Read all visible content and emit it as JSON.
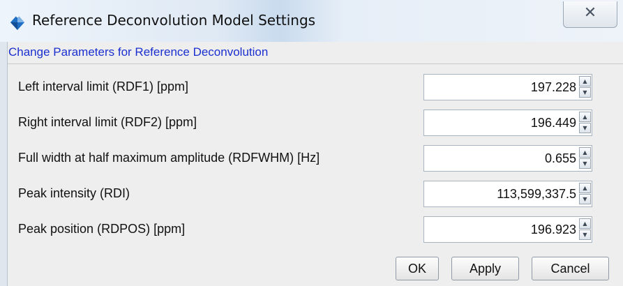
{
  "window": {
    "title": "Reference Deconvolution Model Settings",
    "icon": "app-diamond-icon",
    "close_icon": "close-icon"
  },
  "section": {
    "title": "Change Parameters for Reference Deconvolution"
  },
  "fields": [
    {
      "label": "Left interval limit (RDF1) [ppm]",
      "value": "197.228"
    },
    {
      "label": "Right interval limit (RDF2) [ppm]",
      "value": "196.449"
    },
    {
      "label": "Full width at half maximum amplitude (RDFWHM) [Hz]",
      "value": "0.655"
    },
    {
      "label": "Peak intensity (RDI)",
      "value": "113,599,337.5"
    },
    {
      "label": "Peak position (RDPOS) [ppm]",
      "value": "196.923"
    }
  ],
  "buttons": {
    "ok": "OK",
    "apply": "Apply",
    "cancel": "Cancel"
  },
  "colors": {
    "section_title": "#1b2fd0",
    "title_icon": "#1e6fc4"
  }
}
